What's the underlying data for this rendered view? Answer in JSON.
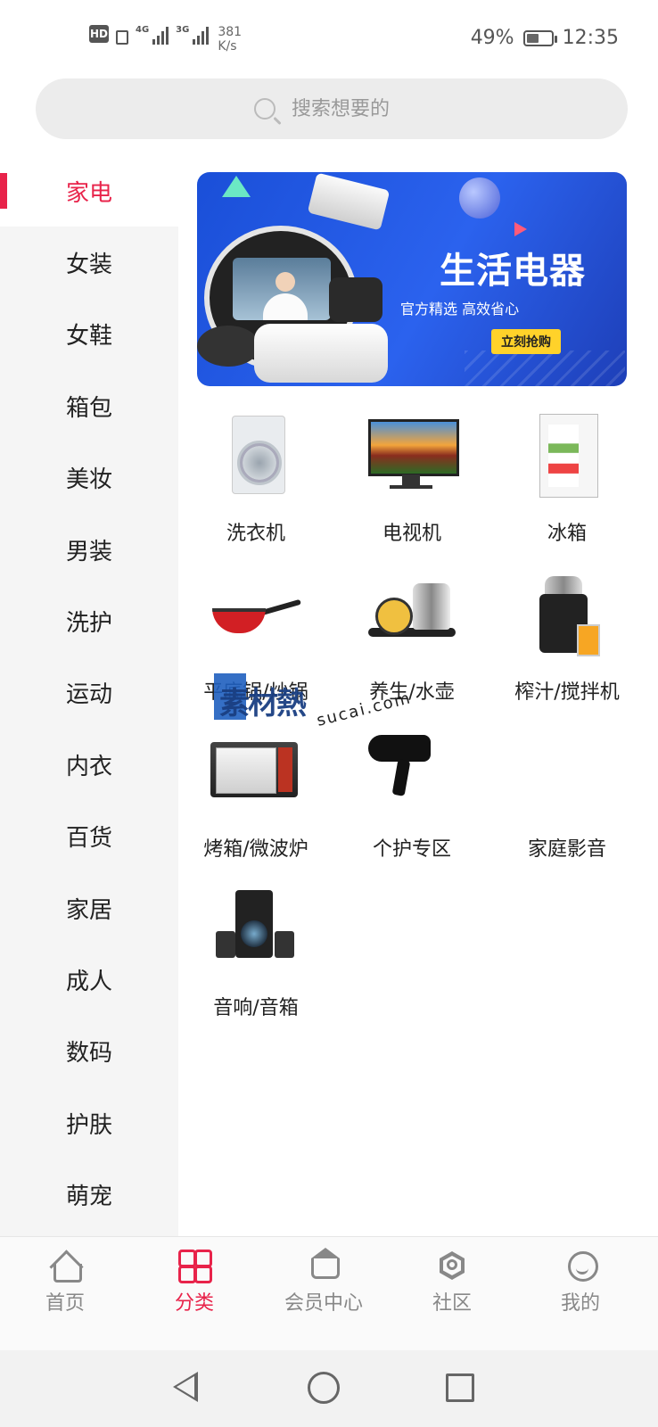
{
  "status_bar": {
    "hd": "HD",
    "net1": "4G",
    "net2": "3G",
    "speed_value": "381",
    "speed_unit": "K/s",
    "battery": "49%",
    "battery_level": 0.49,
    "time": "12:35"
  },
  "search": {
    "placeholder": "搜索想要的"
  },
  "sidebar": {
    "items": [
      "家电",
      "女装",
      "女鞋",
      "箱包",
      "美妆",
      "男装",
      "洗护",
      "运动",
      "内衣",
      "百货",
      "家居",
      "成人",
      "数码",
      "护肤",
      "萌宠"
    ],
    "active_index": 0
  },
  "banner": {
    "title": "生活电器",
    "subtitle": "官方精选 高效省心",
    "cta": "立刻抢购"
  },
  "products": [
    {
      "name": "洗衣机",
      "icon": "washing-machine"
    },
    {
      "name": "电视机",
      "icon": "television"
    },
    {
      "name": "冰箱",
      "icon": "refrigerator"
    },
    {
      "name": "平底锅/炒锅",
      "icon": "frying-pan"
    },
    {
      "name": "养生/水壶",
      "icon": "kettle"
    },
    {
      "name": "榨汁/搅拌机",
      "icon": "juicer"
    },
    {
      "name": "烤箱/微波炉",
      "icon": "microwave"
    },
    {
      "name": "个护专区",
      "icon": "hair-dryer"
    },
    {
      "name": "家庭影音",
      "icon": ""
    },
    {
      "name": "音响/音箱",
      "icon": "speaker-system"
    }
  ],
  "watermark": {
    "cn": "素材熱",
    "en": "sucai.com"
  },
  "bottom_nav": {
    "items": [
      {
        "label": "首页",
        "icon": "home-icon"
      },
      {
        "label": "分类",
        "icon": "category-grid-icon"
      },
      {
        "label": "会员中心",
        "icon": "crown-icon"
      },
      {
        "label": "社区",
        "icon": "hexagon-icon"
      },
      {
        "label": "我的",
        "icon": "profile-face-icon"
      }
    ],
    "active_index": 1
  },
  "colors": {
    "accent": "#e8234a",
    "sidebar_bg": "#f5f5f5",
    "banner_blue": "#2b62ee",
    "cta_yellow": "#ffd22a"
  }
}
